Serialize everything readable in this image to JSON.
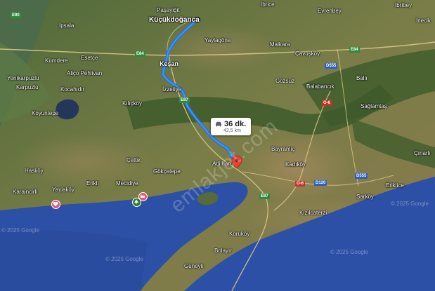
{
  "map": {
    "colors": {
      "sea": "#2c50a5",
      "land": "#6b7a45",
      "route": "#1a73e8",
      "destination_pin": "#ea4335"
    },
    "route_info": {
      "icon": "car-icon",
      "duration": "36 dk.",
      "distance": "42,5 km"
    },
    "origin": "Küçükdoğanca",
    "places": [
      {
        "id": "pasayigit",
        "name": "Paşayiğit"
      },
      {
        "id": "ibrice",
        "name": "İbrice"
      },
      {
        "id": "evrenbey",
        "name": "Evrenbey"
      },
      {
        "id": "ibribey",
        "name": "İbribey"
      },
      {
        "id": "ipsala",
        "name": "İpsala"
      },
      {
        "id": "inecik",
        "name": "İnecik"
      },
      {
        "id": "yaylagone",
        "name": "Yaylagöne"
      },
      {
        "id": "malkara",
        "name": "Malkara"
      },
      {
        "id": "esetce",
        "name": "Esetçe"
      },
      {
        "id": "kumdere",
        "name": "Kumdere"
      },
      {
        "id": "cavuskoy",
        "name": "Çavuşköy"
      },
      {
        "id": "kesan",
        "name": "Keşan"
      },
      {
        "id": "alicopehlivan",
        "name": "Aliço Pehlivan"
      },
      {
        "id": "yenikarpuzlu",
        "name": "Yenikarpuzlu"
      },
      {
        "id": "karpuzlu",
        "name": "Karpuzlu"
      },
      {
        "id": "gozsuz",
        "name": "Gözsüz"
      },
      {
        "id": "kocahidir",
        "name": "Kocahıdır"
      },
      {
        "id": "balabancik",
        "name": "Balabancık"
      },
      {
        "id": "balli",
        "name": "Ballı"
      },
      {
        "id": "izzetiye",
        "name": "İzzetiye"
      },
      {
        "id": "kilickoy",
        "name": "Kılıçköy"
      },
      {
        "id": "saglamtas",
        "name": "Sağlamtaş"
      },
      {
        "id": "koyuntepe",
        "name": "Koyuntepe"
      },
      {
        "id": "bayramic",
        "name": "Bayramiç"
      },
      {
        "id": "adilhan",
        "name": "Adilhan"
      },
      {
        "id": "kadikoy",
        "name": "Kadıköy"
      },
      {
        "id": "cinarli",
        "name": "Çınarlı"
      },
      {
        "id": "celtik",
        "name": "Çeltik"
      },
      {
        "id": "haskoy",
        "name": "Hasköy"
      },
      {
        "id": "gokcetepe",
        "name": "Gökçetepe"
      },
      {
        "id": "mecidiye",
        "name": "Mecidiye"
      },
      {
        "id": "erikli",
        "name": "Erikli"
      },
      {
        "id": "yaylakoy",
        "name": "Yaylaköy"
      },
      {
        "id": "karaincirli",
        "name": "Karaincirli"
      },
      {
        "id": "eriklice",
        "name": "Eriklice"
      },
      {
        "id": "sarkoy",
        "name": "Şarköy"
      },
      {
        "id": "kizilcaterzi",
        "name": "Kızılcaterzi"
      },
      {
        "id": "korukoy",
        "name": "Koruköy"
      },
      {
        "id": "bolayir",
        "name": "Bolayır"
      },
      {
        "id": "guneyli",
        "name": "Güneyli"
      }
    ],
    "road_shields": [
      {
        "id": "e90",
        "label": "E90",
        "color": "green"
      },
      {
        "id": "e84a",
        "label": "E84",
        "color": "green"
      },
      {
        "id": "e84b",
        "label": "E84",
        "color": "green"
      },
      {
        "id": "e87a",
        "label": "E87",
        "color": "green"
      },
      {
        "id": "e87b",
        "label": "E87",
        "color": "green"
      },
      {
        "id": "d555a",
        "label": "D555",
        "color": "blue"
      },
      {
        "id": "d555b",
        "label": "D555",
        "color": "blue"
      },
      {
        "id": "o6a",
        "label": "O-6",
        "color": "red"
      },
      {
        "id": "o6b",
        "label": "O-6",
        "color": "red"
      },
      {
        "id": "d120",
        "label": "D120",
        "color": "blue"
      }
    ],
    "copyright": [
      {
        "id": "c1",
        "text": "© 2025 Google"
      },
      {
        "id": "c2",
        "text": "© 2025 Google"
      },
      {
        "id": "c3",
        "text": "© 2025 Google"
      },
      {
        "id": "c4",
        "text": "© 2025 Google"
      }
    ],
    "watermark": "emlakjet.com"
  }
}
